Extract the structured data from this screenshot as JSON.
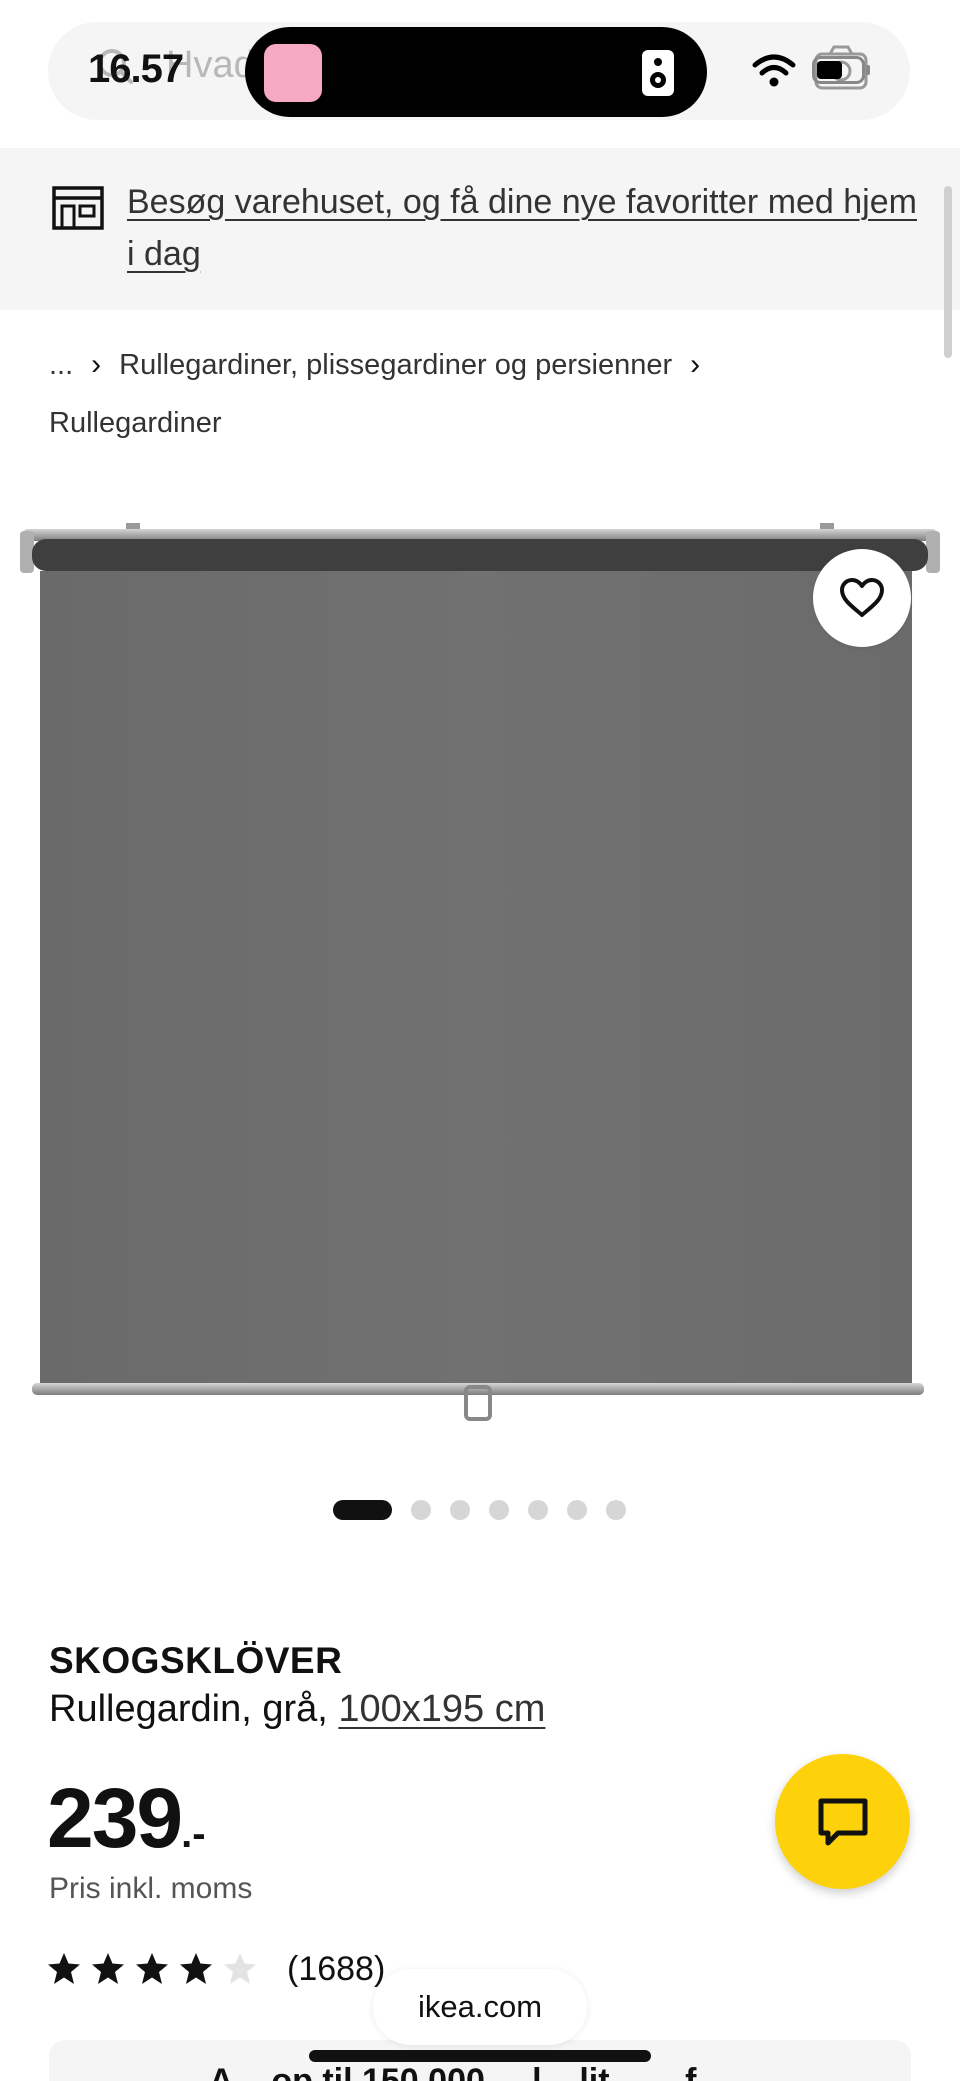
{
  "status_bar": {
    "time": "16.57"
  },
  "search": {
    "placeholder": "Hvad"
  },
  "store_banner": {
    "link_text": "Besøg varehuset, og få dine nye favoritter med hjem i dag"
  },
  "breadcrumb": {
    "items": [
      "...",
      "Rullegardiner, plissegardiner og persienner",
      "Rullegardiner"
    ]
  },
  "carousel": {
    "total_images": 7,
    "active_index": 0
  },
  "product": {
    "name": "SKOGSKLÖVER",
    "description": "Rullegardin, grå, ",
    "size": "100x195 cm",
    "price": "239",
    "price_suffix": ".-",
    "price_note": "Pris inkl. moms",
    "rating": 4,
    "rating_max": 5,
    "review_count": "(1688)"
  },
  "promo": {
    "text_partial": "A... op til 150.000 ... l... lit... ... f..."
  },
  "browser": {
    "url": "ikea.com"
  },
  "colors": {
    "accent_yellow": "#fdd20a",
    "banner_bg": "#f5f5f5",
    "blind_fabric": "#6e6e6e",
    "text_dark": "#111111"
  },
  "icons": {
    "search": "search-icon",
    "camera": "camera-icon",
    "store": "store-icon",
    "favorite": "heart-icon",
    "chat": "chat-icon",
    "wifi": "wifi-icon",
    "battery": "battery-icon"
  }
}
